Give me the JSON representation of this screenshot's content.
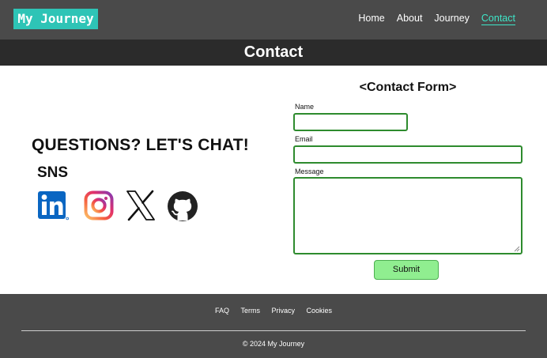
{
  "header": {
    "logo": "My Journey",
    "nav": [
      {
        "label": "Home"
      },
      {
        "label": "About"
      },
      {
        "label": "Journey"
      },
      {
        "label": "Contact"
      }
    ],
    "active_nav": "Contact"
  },
  "page_title": "Contact",
  "left": {
    "heading": "QUESTIONS? LET'S CHAT!",
    "sns_heading": "SNS",
    "sns_icons": [
      "linkedin-icon",
      "instagram-icon",
      "x-icon",
      "github-icon"
    ]
  },
  "form": {
    "title": "<Contact Form>",
    "name_label": "Name",
    "email_label": "Email",
    "message_label": "Message",
    "submit_label": "Submit"
  },
  "footer": {
    "links": [
      "FAQ",
      "Terms",
      "Privacy",
      "Cookies"
    ],
    "copyright": "© 2024 My Journey"
  },
  "colors": {
    "header_bg": "#4a4a4a",
    "title_bar_bg": "#2b2b2b",
    "logo_bg": "#2ec4b6",
    "active_nav": "#3ee6c8",
    "input_border": "#2e8b2e",
    "submit_bg": "#90ee90"
  }
}
